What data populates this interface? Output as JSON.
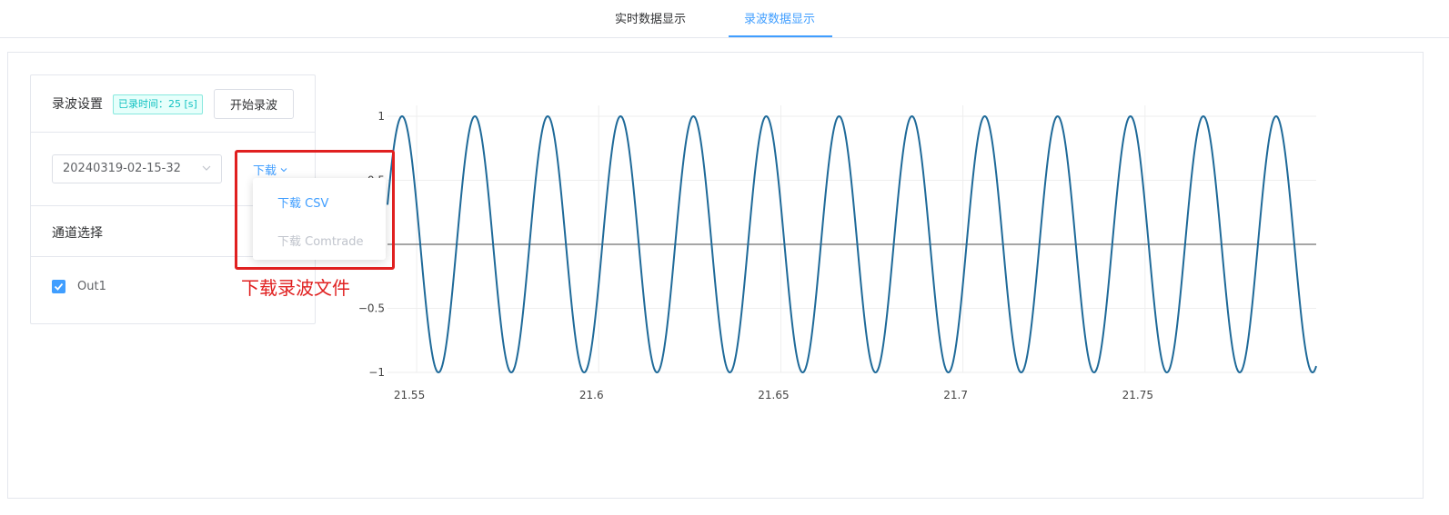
{
  "tabs": [
    {
      "label": "实时数据显示",
      "active": false
    },
    {
      "label": "录波数据显示",
      "active": true
    }
  ],
  "recording": {
    "title": "录波设置",
    "time_tag": "已录时间：25 [s]",
    "start_button": "开始录波",
    "file_select": "20240319-02-15-32",
    "download_label": "下载",
    "download_menu": [
      {
        "label": "下载 CSV",
        "enabled": true
      },
      {
        "label": "下载 Comtrade",
        "enabled": false
      }
    ]
  },
  "channels": {
    "title": "通道选择",
    "items": [
      {
        "label": "Out1",
        "checked": true
      }
    ]
  },
  "annotation": {
    "text": "下载录波文件",
    "color": "#e02020"
  },
  "colors": {
    "accent": "#409eff",
    "line": "#1f6a99",
    "zero_line": "#888888"
  },
  "chart_data": {
    "type": "line",
    "x_range": [
      21.542,
      21.797
    ],
    "y_range": [
      -1,
      1
    ],
    "xticks": [
      21.55,
      21.6,
      21.65,
      21.7,
      21.75
    ],
    "xtick_labels": [
      "21.55",
      "21.6",
      "21.65",
      "21.7",
      "21.75"
    ],
    "yticks": [
      1,
      0.5,
      -0.5,
      -1
    ],
    "ytick_labels": [
      "1",
      "0.5",
      "−0.5",
      "−1"
    ],
    "zero_line": true,
    "grid": true,
    "series": [
      {
        "function": "sine",
        "frequency_hz": 50,
        "amplitude": 1,
        "peak_at_x": 21.546
      }
    ]
  }
}
